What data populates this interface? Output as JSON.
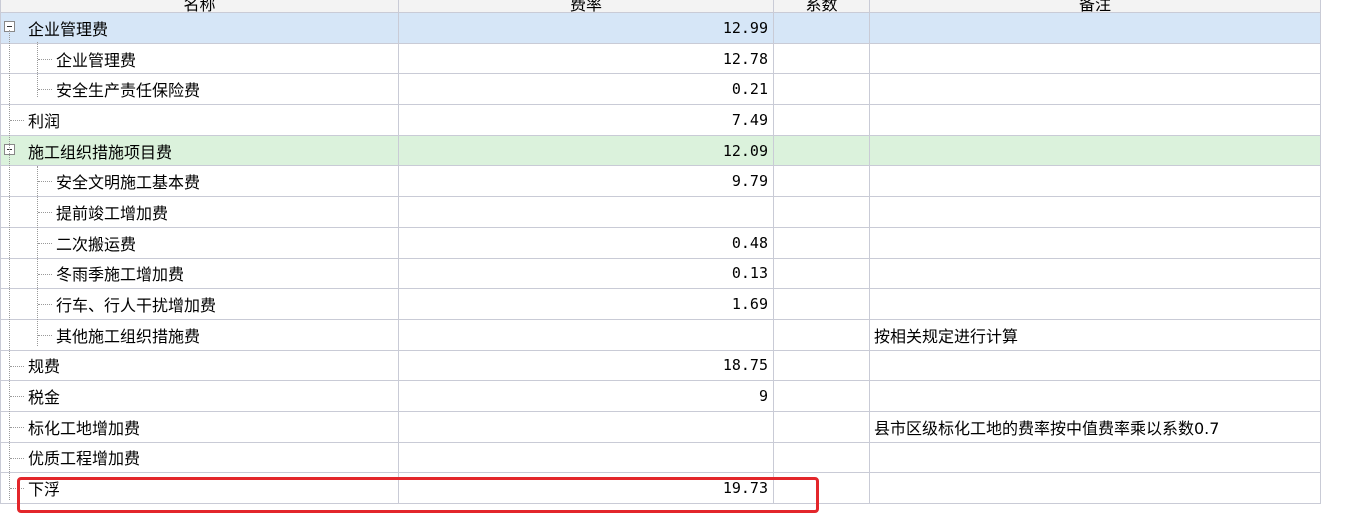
{
  "columns": {
    "name": "名称",
    "rate": "费率",
    "coef": "系数",
    "note": "备注"
  },
  "rows": [
    {
      "name": "企业管理费",
      "rate": "12.99",
      "coef": "",
      "note": "",
      "level": 0,
      "expander": true,
      "highlight": "blue"
    },
    {
      "name": "企业管理费",
      "rate": "12.78",
      "coef": "",
      "note": "",
      "level": 1
    },
    {
      "name": "安全生产责任保险费",
      "rate": "0.21",
      "coef": "",
      "note": "",
      "level": 1
    },
    {
      "name": "利润",
      "rate": "7.49",
      "coef": "",
      "note": "",
      "level": 0
    },
    {
      "name": "施工组织措施项目费",
      "rate": "12.09",
      "coef": "",
      "note": "",
      "level": 0,
      "expander": true,
      "highlight": "green"
    },
    {
      "name": "安全文明施工基本费",
      "rate": "9.79",
      "coef": "",
      "note": "",
      "level": 1
    },
    {
      "name": "提前竣工增加费",
      "rate": "",
      "coef": "",
      "note": "",
      "level": 1
    },
    {
      "name": "二次搬运费",
      "rate": "0.48",
      "coef": "",
      "note": "",
      "level": 1
    },
    {
      "name": "冬雨季施工增加费",
      "rate": "0.13",
      "coef": "",
      "note": "",
      "level": 1
    },
    {
      "name": "行车、行人干扰增加费",
      "rate": "1.69",
      "coef": "",
      "note": "",
      "level": 1
    },
    {
      "name": "其他施工组织措施费",
      "rate": "",
      "coef": "",
      "note": "按相关规定进行计算",
      "level": 1
    },
    {
      "name": "规费",
      "rate": "18.75",
      "coef": "",
      "note": "",
      "level": 0
    },
    {
      "name": "税金",
      "rate": "9",
      "coef": "",
      "note": "",
      "level": 0
    },
    {
      "name": "标化工地增加费",
      "rate": "",
      "coef": "",
      "note": "县市区级标化工地的费率按中值费率乘以系数0.7",
      "level": 0
    },
    {
      "name": "优质工程增加费",
      "rate": "",
      "coef": "",
      "note": "",
      "level": 0
    },
    {
      "name": "下浮",
      "rate": "19.73",
      "coef": "",
      "note": "",
      "level": 0,
      "selected": true
    }
  ],
  "colors": {
    "highlight_blue": "#d6e6f7",
    "highlight_green": "#dbf2dc",
    "annotation_box": "#e3262b"
  },
  "icons": {
    "collapse": "minus-box-icon"
  }
}
